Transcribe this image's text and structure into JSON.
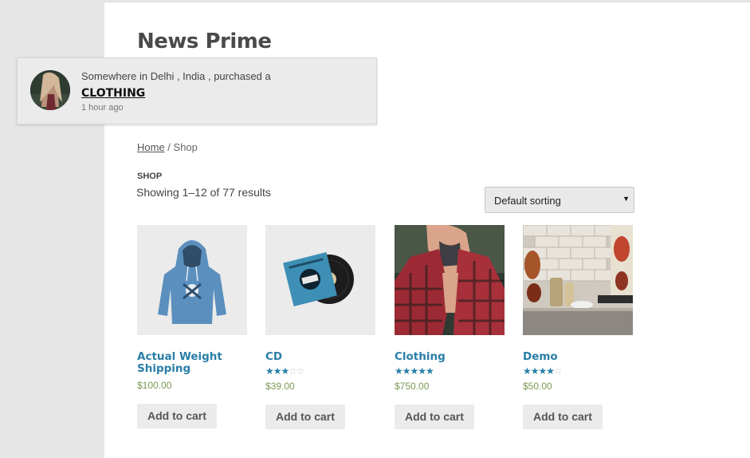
{
  "site": {
    "title": "News Prime"
  },
  "breadcrumb": {
    "home": "Home",
    "separator": " / ",
    "current": "Shop"
  },
  "shop": {
    "heading": "SHOP",
    "result_count": "Showing 1–12 of 77 results",
    "sorting": {
      "selected": "Default sorting",
      "icon": "dropdown-arrow-icon"
    }
  },
  "products": [
    {
      "name": "Actual Weight Shipping",
      "rating": 0,
      "price": "$100.00",
      "button": "Add to cart",
      "image": "hoodie-image"
    },
    {
      "name": "CD",
      "rating": 3,
      "price": "$39.00",
      "button": "Add to cart",
      "image": "album-cd-image"
    },
    {
      "name": "Clothing",
      "rating": 5,
      "price": "$750.00",
      "button": "Add to cart",
      "image": "flannel-shirt-photo"
    },
    {
      "name": "Demo",
      "rating": 3.5,
      "price": "$50.00",
      "button": "Add to cart",
      "image": "kitchen-photo"
    }
  ],
  "notification": {
    "message": "Somewhere in Delhi , India , purchased a",
    "product": "CLOTHING",
    "time": "1 hour ago",
    "avatar": "customer-avatar-photo"
  },
  "colors": {
    "accent": "#2a7ea7",
    "price": "#7a9a54",
    "background": "#e6e6e6"
  }
}
